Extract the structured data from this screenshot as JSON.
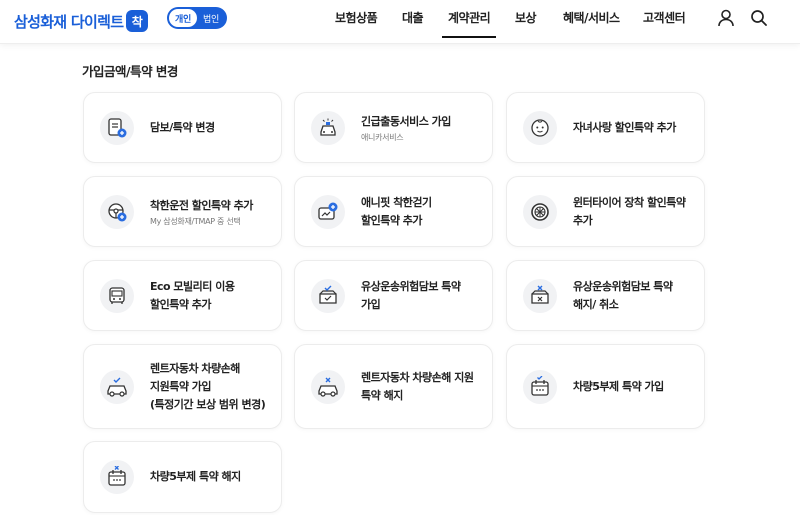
{
  "header": {
    "logo_text": "삼성화재 다이렉트",
    "logo_badge": "착",
    "segment": {
      "personal": "개인",
      "corporate": "법인",
      "selected": "personal"
    },
    "nav": [
      "보험상품",
      "대출",
      "계약관리",
      "보상",
      "혜택/서비스",
      "고객센터"
    ],
    "active_nav": "계약관리",
    "icons": [
      "user-icon",
      "search-icon"
    ]
  },
  "section_title": "가입금액/특약 변경",
  "cards": [
    {
      "title": [
        "담보/특약 변경"
      ],
      "sub": "",
      "icon": "document-plus-icon"
    },
    {
      "title": [
        "긴급출동서비스 가입"
      ],
      "sub": "애니카서비스",
      "icon": "emergency-car-icon"
    },
    {
      "title": [
        "자녀사랑 할인특약 추가"
      ],
      "sub": "",
      "icon": "baby-face-icon"
    },
    {
      "title": [
        "착한운전 할인특약 추가"
      ],
      "sub": "My 삼성화재/TMAP 중 선택",
      "icon": "steering-wheel-icon"
    },
    {
      "title": [
        "애니핏 착한걷기",
        "할인특약 추가"
      ],
      "sub": "",
      "icon": "walking-card-icon"
    },
    {
      "title": [
        "윈터타이어 장착 할인특약",
        "추가"
      ],
      "sub": "",
      "icon": "winter-tire-icon"
    },
    {
      "title": [
        "Eco 모빌리티 이용",
        "할인특약 추가"
      ],
      "sub": "",
      "icon": "bus-icon"
    },
    {
      "title": [
        "유상운송위험담보 특약",
        "가입"
      ],
      "sub": "",
      "icon": "delivery-box-check-icon"
    },
    {
      "title": [
        "유상운송위험담보 특약",
        "해지/ 취소"
      ],
      "sub": "",
      "icon": "delivery-box-x-icon"
    },
    {
      "title": [
        "렌트자동차 차량손해",
        "지원특약 가입",
        "(특정기간 보상 범위 변경)"
      ],
      "sub": "",
      "icon": "rental-car-check-icon"
    },
    {
      "title": [
        "렌트자동차 차량손해 지원",
        "특약 해지"
      ],
      "sub": "",
      "icon": "rental-car-x-icon"
    },
    {
      "title": [
        "차량5부제 특약 가입"
      ],
      "sub": "",
      "icon": "calendar-check-icon"
    },
    {
      "title": [
        "차량5부제 특약 해지"
      ],
      "sub": "",
      "icon": "calendar-x-icon"
    }
  ]
}
